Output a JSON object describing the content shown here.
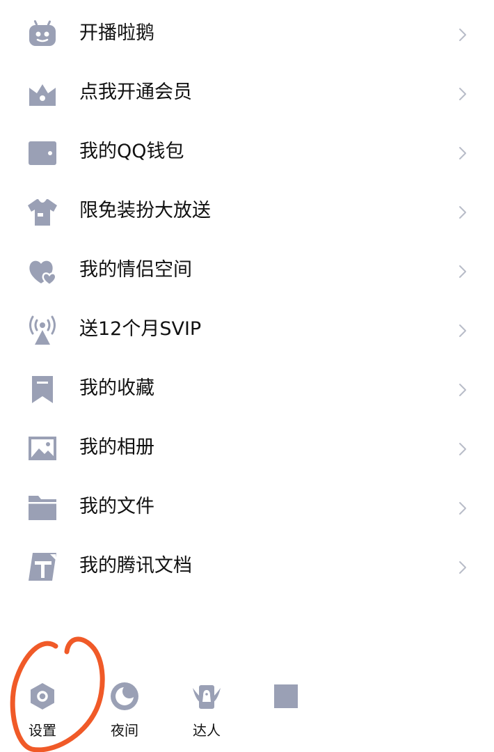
{
  "menu": {
    "items": [
      {
        "label": "开播啦鹅",
        "icon": "tv-robot-icon"
      },
      {
        "label": "点我开通会员",
        "icon": "crown-icon"
      },
      {
        "label": "我的QQ钱包",
        "icon": "wallet-icon"
      },
      {
        "label": "限免装扮大放送",
        "icon": "shirt-icon"
      },
      {
        "label": "我的情侣空间",
        "icon": "hearts-icon"
      },
      {
        "label": "送12个月SVIP",
        "icon": "broadcast-icon"
      },
      {
        "label": "我的收藏",
        "icon": "bookmark-icon"
      },
      {
        "label": "我的相册",
        "icon": "photo-icon"
      },
      {
        "label": "我的文件",
        "icon": "folder-icon"
      },
      {
        "label": "我的腾讯文档",
        "icon": "docs-icon"
      }
    ]
  },
  "bottom": {
    "settings_label": "设置",
    "night_label": "夜间",
    "talent_label": "达人"
  },
  "colors": {
    "icon": "#9aa0b5",
    "arrow": "#b8bcc8",
    "text": "#111111",
    "annotation": "#f05a28"
  }
}
